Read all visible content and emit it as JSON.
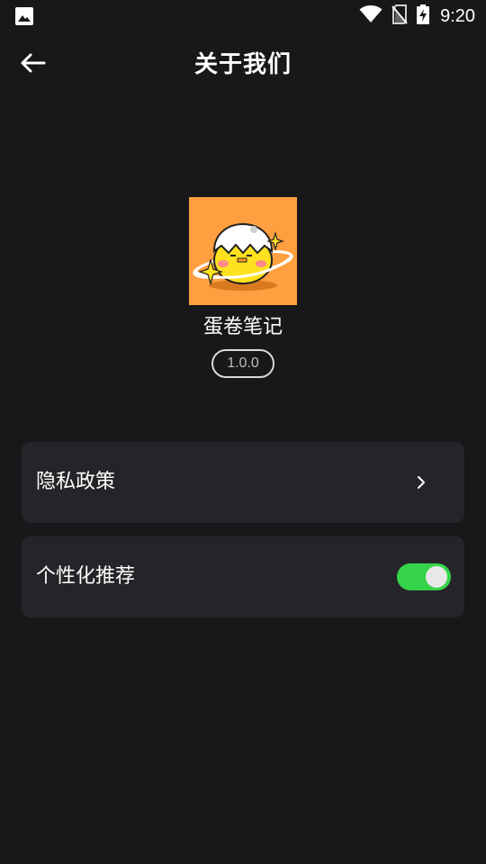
{
  "status_bar": {
    "time": "9:20",
    "left_icon": "image-icon",
    "right_icons": [
      "wifi-icon",
      "no-sim-icon",
      "battery-charging-icon"
    ]
  },
  "header": {
    "title": "关于我们",
    "back_icon": "arrow-left-icon"
  },
  "app": {
    "name": "蛋卷笔记",
    "version": "1.0.0",
    "logo_icon": "egg-chick-logo",
    "logo_bg": "#ff9f3f"
  },
  "settings": {
    "privacy_label": "隐私政策",
    "privacy_icon": "chevron-right-icon",
    "personalized_label": "个性化推荐",
    "personalized_enabled": true
  },
  "colors": {
    "background": "#18181a",
    "card": "#252529",
    "toggle_on": "#35d44a"
  }
}
